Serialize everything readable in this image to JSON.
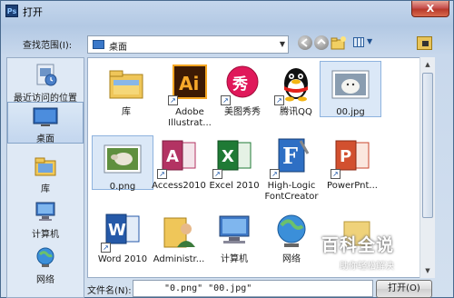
{
  "window": {
    "title": "打开",
    "app_icon_text": "Ps",
    "close_symbol": "X"
  },
  "toolbar": {
    "look_in_label": "查找范围(I):",
    "location": "桌面",
    "dropdown_symbol": "▼"
  },
  "sidebar": {
    "items": [
      {
        "label": "最近访问的位置",
        "icon": "recent-places-icon"
      },
      {
        "label": "桌面",
        "icon": "desktop-icon",
        "selected": true
      },
      {
        "label": "库",
        "icon": "libraries-icon"
      },
      {
        "label": "计算机",
        "icon": "computer-icon"
      },
      {
        "label": "网络",
        "icon": "network-icon"
      }
    ]
  },
  "files": [
    {
      "name": "库",
      "icon": "libraries-folder-icon"
    },
    {
      "name": "Adobe Illustrat...",
      "icon": "adobe-illustrator-icon",
      "shortcut": true
    },
    {
      "name": "美图秀秀",
      "icon": "meitu-icon",
      "shortcut": true
    },
    {
      "name": "腾讯QQ",
      "icon": "qq-penguin-icon",
      "shortcut": true
    },
    {
      "name": "00.jpg",
      "icon": "image-thumbnail-icon",
      "selected": true
    },
    {
      "name": "0.png",
      "icon": "image-thumbnail-icon",
      "selected": true
    },
    {
      "name": "Access2010",
      "icon": "access-icon",
      "shortcut": true
    },
    {
      "name": "Excel 2010",
      "icon": "excel-icon",
      "shortcut": true
    },
    {
      "name": "High-Logic FontCreator",
      "icon": "fontcreator-icon",
      "shortcut": true
    },
    {
      "name": "PowerPnt...",
      "icon": "powerpoint-icon",
      "shortcut": true
    },
    {
      "name": "Word 2010",
      "icon": "word-icon",
      "shortcut": true
    },
    {
      "name": "Administr...",
      "icon": "user-folder-icon"
    },
    {
      "name": "计算机",
      "icon": "computer-icon"
    },
    {
      "name": "网络",
      "icon": "network-icon"
    },
    {
      "name": "",
      "icon": "folder-icon"
    }
  ],
  "bottom": {
    "filename_label": "文件名(N):",
    "filename_value": "\"0.png\" \"00.jpg\"",
    "open_button": "打开(O)"
  },
  "watermark": {
    "main": "百科全说",
    "sub": "助你轻松解决"
  },
  "colors": {
    "selection": "#dbe8f7",
    "title_gradient_top": "#c4d6ec",
    "close_red": "#c75050"
  }
}
